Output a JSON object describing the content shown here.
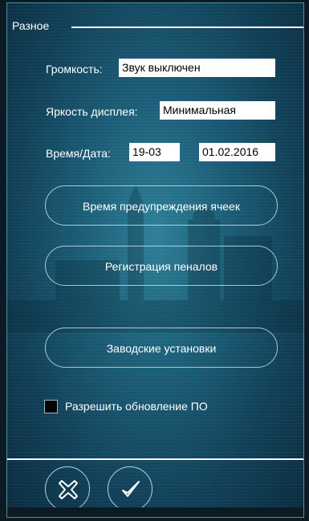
{
  "section": {
    "title": "Разное"
  },
  "volume": {
    "label": "Громкость:",
    "value": "Звук выключен"
  },
  "brightness": {
    "label": "Яркость дисплея:",
    "value": "Минимальная"
  },
  "datetime": {
    "label": "Время/Дата:",
    "time": "19-03",
    "date": "01.02.2016"
  },
  "buttons": {
    "cell_warning_time": "Время предупреждения ячеек",
    "pencil_case_registration": "Регистрация пеналов",
    "factory_settings": "Заводские установки"
  },
  "firmware_update": {
    "label": "Разрешить обновление ПО",
    "checked": false
  },
  "footer": {
    "cancel_icon": "cancel-x-icon",
    "ok_icon": "checkmark-icon"
  },
  "colors": {
    "accent": "#1c5d77",
    "text": "#ffffff",
    "field_bg": "#ffffff"
  }
}
